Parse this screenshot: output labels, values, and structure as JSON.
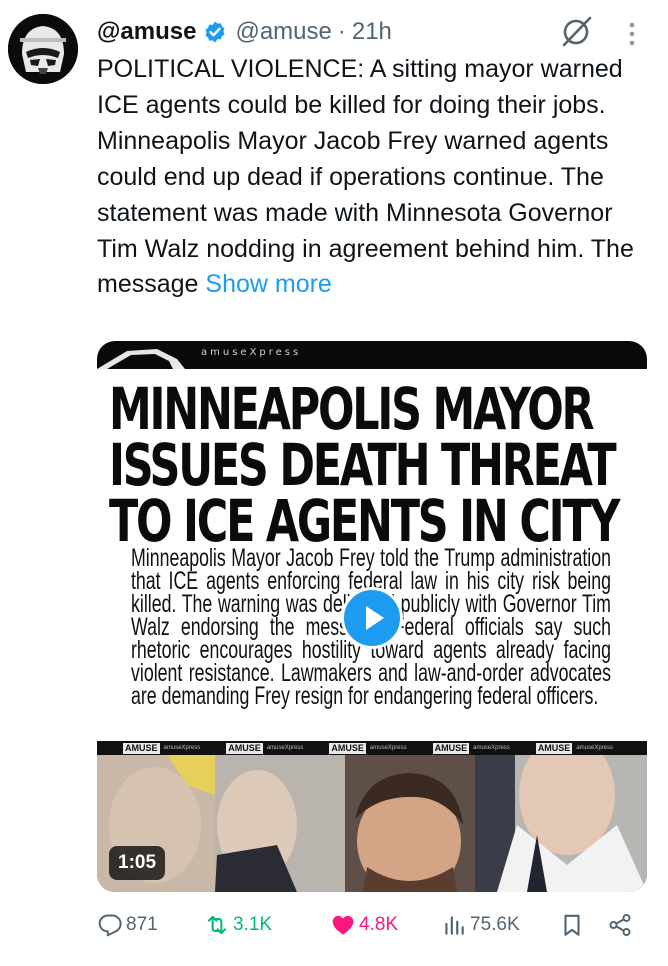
{
  "tweet": {
    "display_name": "@amuse",
    "handle": "@amuse",
    "separator": "·",
    "time": "21h",
    "text": "POLITICAL VIOLENCE: A sitting mayor warned ICE agents could be killed for doing their jobs. Minneapolis Mayor Jacob Frey warned agents could end up dead if operations continue. The statement was made with Minnesota Governor Tim Walz nodding in agreement behind him. The message ",
    "show_more": "Show more"
  },
  "media": {
    "brand": "amuseXpress",
    "headline": "MINNEAPOLIS MAYOR ISSUES DEATH THREAT TO ICE AGENTS IN CITY",
    "body": "Minneapolis Mayor Jacob Frey told the Trump administration that ICE agents enforcing federal law in his city risk being killed. The warning was delivered publicly with Governor Tim Walz endorsing the message. Federal officials say such rhetoric encourages hostility toward agents already facing violent resistance. Lawmakers and law-and-order advocates are demanding Frey resign for endangering federal officers.",
    "strip_logo": "AMUSE",
    "strip_sub": "amuseXpress",
    "duration": "1:05"
  },
  "actions": {
    "replies": "871",
    "reposts": "3.1K",
    "likes": "4.8K",
    "views": "75.6K"
  },
  "icons": [
    "verified-badge-icon",
    "grok-icon",
    "more-icon",
    "play-icon",
    "reply-icon",
    "repost-icon",
    "like-icon",
    "views-icon",
    "bookmark-icon",
    "share-icon"
  ],
  "colors": {
    "accent": "#1d9bf0",
    "repost": "#00ba7c",
    "like": "#f91880",
    "muted": "#536471"
  }
}
